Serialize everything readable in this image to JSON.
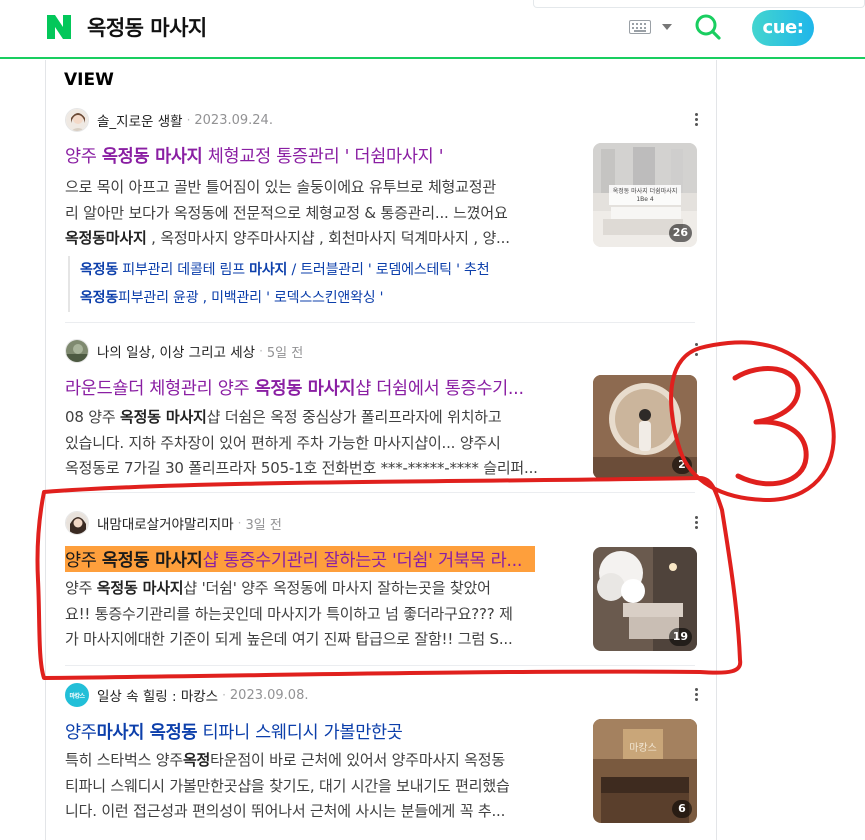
{
  "header": {
    "logo": "N",
    "query": "옥정동 마사지",
    "cue_label": "cue:"
  },
  "view": {
    "title": "VIEW"
  },
  "results": [
    {
      "author": "솔_지로운 생활",
      "date": "2023.09.24.",
      "title_pre": "양주 ",
      "title_bold": "옥정동 마사지",
      "title_post": " 체형교정 통증관리 ' 더쉼마사지 '",
      "desc_lines": [
        {
          "pre": "으로 목이 아프고 골반 틀어짐이 있는 솔둥이에요 유투브로 체형교정관",
          "bold": "",
          "post": ""
        },
        {
          "pre": "리 알아만 보다가 옥정동에 전문적으로 체형교정 & 통증관리... 느꼈어요",
          "bold": "",
          "post": ""
        },
        {
          "pre": "",
          "bold": "옥정동마사지",
          "post": " , 옥정마사지 양주마사지샵 , 회천마사지 덕계마사지 , 양..."
        }
      ],
      "image_count": "26",
      "related": [
        {
          "bold1": "옥정동",
          "mid": " 피부관리 데콜테 림프 ",
          "bold2": "마사지",
          "post": " / 트러블관리 ' 로뎀에스테틱 ' 추천"
        },
        {
          "bold1": "옥정동",
          "mid": "피부관리 윤광 , 미백관리 ' 로덱스스킨앤왁싱 '",
          "bold2": "",
          "post": ""
        }
      ]
    },
    {
      "author": "나의 일상, 이상 그리고 세상",
      "date": "5일 전",
      "title_pre": "라운드숄더 체형관리 양주 ",
      "title_bold": "옥정동 마사지",
      "title_post": "샵 더쉼에서 통증수기...",
      "desc_lines": [
        {
          "pre": "08 양주 ",
          "bold": "옥정동 마사지",
          "post": "샵 더쉼은 옥정 중심상가 폴리프라자에 위치하고"
        },
        {
          "pre": "있습니다. 지하 주차장이 있어 편하게 주차 가능한 마사지샵이... 양주시",
          "bold": "",
          "post": ""
        },
        {
          "pre": "옥정동로 7가길 30 폴리프라자 505-1호 전화번호 ***-*****-**** 슬리퍼...",
          "bold": "",
          "post": ""
        }
      ],
      "image_count": "2"
    },
    {
      "author": "내맘대로살거야말리지마",
      "date": "3일 전",
      "title_pre": "양주 ",
      "title_bold": "옥정동 마사지",
      "title_post": "샵 통증수기관리 잘하는곳 '더쉼' 거북목 라...",
      "desc_lines": [
        {
          "pre": "양주 ",
          "bold": "옥정동 마사지",
          "post": "샵 '더쉼' 양주 옥정동에 마사지 잘하는곳을 찾았어"
        },
        {
          "pre": "요!! 통증수기관리를 하는곳인데 마사지가 특이하고 넘 좋더라구요??? 제",
          "bold": "",
          "post": ""
        },
        {
          "pre": "가 마사지에대한 기준이 되게 높은데 여기 진짜 탑급으로 잘함!! 그럼 S...",
          "bold": "",
          "post": ""
        }
      ],
      "image_count": "19"
    },
    {
      "author": "일상 속 힐링 : 마캉스",
      "avatar_text": "마캉스",
      "date": "2023.09.08.",
      "title_pre": "양주",
      "title_bold": "마사지 옥정동",
      "title_post": " 티파니 스웨디시 가볼만한곳",
      "desc_lines": [
        {
          "pre": "특히 스타벅스 양주",
          "bold": "옥정",
          "post": "타운점이 바로 근처에 있어서 양주마사지 옥정동"
        },
        {
          "pre": "티파니 스웨디시 가볼만한곳샵을 찾기도, 대기 시간을 보내기도 편리했습",
          "bold": "",
          "post": ""
        },
        {
          "pre": "니다. 이런 접근성과 편의성이 뛰어나서 근처에 사시는 분들에게 꼭 추...",
          "bold": "",
          "post": ""
        }
      ],
      "image_count": "6"
    }
  ],
  "annotation": {
    "number": "3",
    "color": "#e0201d"
  },
  "colors": {
    "brand_green": "#19ce60",
    "title_purple": "#8a1fa3",
    "title_blue": "#0c3fab",
    "highlight": "#fe9f3c"
  }
}
